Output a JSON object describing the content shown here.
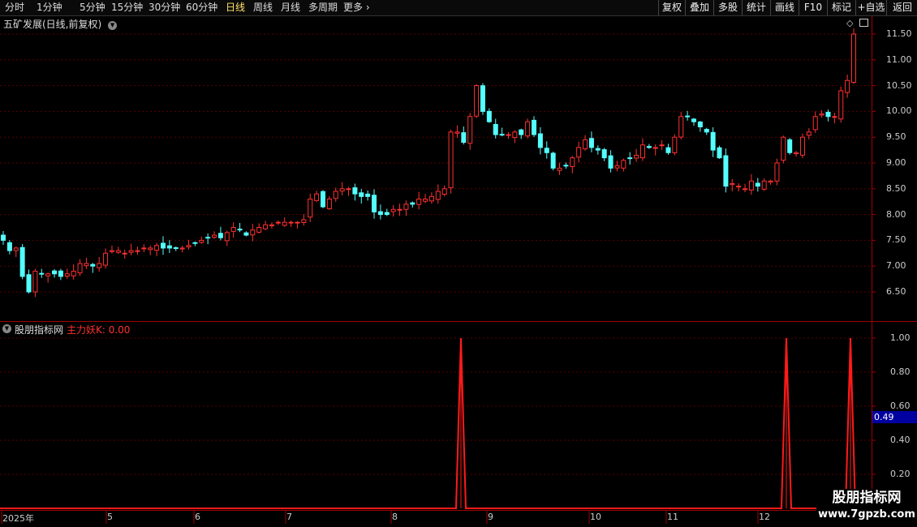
{
  "toolbar": {
    "timeframes": [
      "分时",
      "1分钟",
      "5分钟",
      "15分钟",
      "30分钟",
      "60分钟",
      "日线",
      "周线",
      "月线",
      "多周期",
      "更多"
    ],
    "active_timeframe": "日线",
    "right_buttons": [
      "复权",
      "叠加",
      "多股",
      "统计",
      "画线",
      "F10",
      "标记",
      "+自选",
      "返回"
    ]
  },
  "stock": {
    "title": "五矿发展(日线,前复权)"
  },
  "indicator": {
    "name": "股朋指标网",
    "value_text": "主力妖K: 0.00",
    "cursor_value": "0.49"
  },
  "price_axis": {
    "labels": [
      "11.50",
      "11.00",
      "10.50",
      "10.00",
      "9.50",
      "9.00",
      "8.50",
      "8.00",
      "7.50",
      "7.00",
      "6.50"
    ],
    "values": [
      11.5,
      11.0,
      10.5,
      10.0,
      9.5,
      9.0,
      8.5,
      8.0,
      7.5,
      7.0,
      6.5
    ]
  },
  "indicator_axis": {
    "labels": [
      "1.00",
      "0.80",
      "0.60",
      "0.40",
      "0.20"
    ],
    "values": [
      1.0,
      0.8,
      0.6,
      0.4,
      0.2
    ]
  },
  "x_axis": {
    "labels": [
      "2025年",
      "5",
      "6",
      "7",
      "8",
      "9",
      "10",
      "11",
      "12"
    ]
  },
  "watermark": {
    "line1": "股朋指标网",
    "line2": "www.7gpzb.com"
  },
  "colors": {
    "up": "#ff3030",
    "down": "#54ffff",
    "grid": "#5a0000",
    "indicator_line": "#ff1a1a",
    "active_tab": "#ffe36a"
  },
  "chart_data": {
    "type": "candlestick",
    "ylim": [
      6.0,
      11.7
    ],
    "close_trend": [
      7.5,
      7.3,
      7.35,
      6.8,
      6.5,
      6.9,
      6.85,
      6.85,
      6.85,
      6.8,
      6.85,
      6.9,
      7.05,
      7.05,
      7.0,
      7.05,
      7.25,
      7.3,
      7.3,
      7.25,
      7.3,
      7.3,
      7.35,
      7.35,
      7.4,
      7.35,
      7.35,
      7.35,
      7.35,
      7.4,
      7.45,
      7.5,
      7.55,
      7.6,
      7.55,
      7.65,
      7.75,
      7.7,
      7.6,
      7.7,
      7.75,
      7.8,
      7.8,
      7.85,
      7.85,
      7.85,
      7.85,
      7.9,
      8.3,
      8.4,
      8.15,
      8.3,
      8.45,
      8.5,
      8.5,
      8.4,
      8.35,
      8.35,
      8.05,
      8.0,
      8.0,
      8.1,
      8.1,
      8.2,
      8.2,
      8.3,
      8.3,
      8.35,
      8.45,
      8.5,
      9.6,
      9.6,
      9.4,
      9.9,
      10.5,
      10.0,
      9.8,
      9.55,
      9.55,
      9.55,
      9.6,
      9.55,
      9.8,
      9.55,
      9.3,
      9.2,
      8.9,
      8.9,
      8.95,
      9.1,
      9.3,
      9.45,
      9.3,
      9.25,
      9.1,
      8.9,
      8.95,
      9.05,
      9.1,
      9.15,
      9.35,
      9.3,
      9.3,
      9.35,
      9.2,
      9.5,
      9.9,
      9.9,
      9.8,
      9.7,
      9.6,
      9.25,
      9.1,
      8.55,
      8.6,
      8.55,
      8.5,
      8.65,
      8.55,
      8.65,
      8.65,
      9.0,
      9.5,
      9.2,
      9.2,
      9.5,
      9.6,
      9.9,
      9.95,
      9.9,
      9.9,
      10.4,
      10.6,
      11.5
    ],
    "indicator_spikes": [
      {
        "x_label": "9",
        "value": 1.0
      },
      {
        "x_label": "12",
        "value": 1.0
      },
      {
        "x_label": "12",
        "value": 1.0
      }
    ],
    "baseline_value": 0.0
  }
}
